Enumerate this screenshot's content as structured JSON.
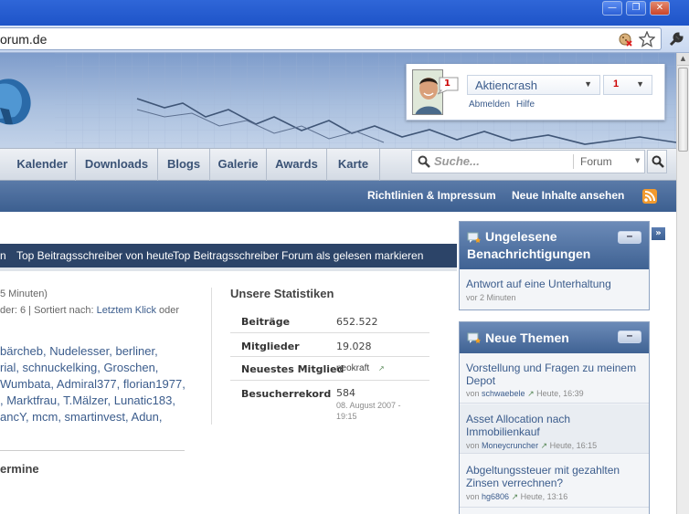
{
  "browser": {
    "url": "orum.de",
    "window_buttons": {
      "minimize": "—",
      "restore": "❐",
      "close": "✕"
    }
  },
  "user": {
    "name": "Aktiencrash",
    "notif_count": "1",
    "badge_count": "1",
    "logout": "Abmelden",
    "help": "Hilfe"
  },
  "nav": {
    "items": [
      "Kalender",
      "Downloads",
      "Blogs",
      "Galerie",
      "Awards",
      "Karte"
    ],
    "search_placeholder": "Suche...",
    "search_scope": "Forum"
  },
  "subnav": {
    "rules": "Richtlinien & Impressum",
    "new_content": "Neue Inhalte ansehen"
  },
  "linkbar": {
    "items": [
      "n",
      "Top Beitragsschreiber von heute",
      "Top Beitragsschreiber",
      "Forum als gelesen markieren"
    ]
  },
  "online": {
    "line1": "5 Minuten)",
    "line2_prefix": "der: 6 | Sortiert nach: ",
    "line2_link": "Letztem Klick",
    "line2_suffix": " oder",
    "users": [
      "bärcheb, Nudelesser, berliner,",
      "rial, schnuckelking, Groschen,",
      "Wumbata, Admiral377, florian1977,",
      ", Marktfrau, T.Mälzer, Lunatic183,",
      "ancY, mcm, smartinvest, Adun,"
    ],
    "termine": "ermine"
  },
  "stats": {
    "title": "Unsere Statistiken",
    "rows": [
      {
        "label": "Beiträge",
        "value": "652.522"
      },
      {
        "label": "Mitglieder",
        "value": "19.028"
      },
      {
        "label": "Neuestes Mitglied",
        "value": "neokraft"
      },
      {
        "label": "Besucherrekord",
        "value": "584",
        "sub": "08. August 2007 - 19:15"
      }
    ]
  },
  "notifications": {
    "title_line1": "Ungelesene",
    "title_line2": "Benachrichtigungen",
    "item_title": "Antwort auf eine Unterhaltung",
    "item_time": "vor 2 Minuten"
  },
  "threads": {
    "title": "Neue Themen",
    "items": [
      {
        "title_line1": "Vorstellung und Fragen zu meinem",
        "title_line2": "Depot",
        "by": "von",
        "author": "schwaebele",
        "time": "Heute, 16:39"
      },
      {
        "title_line1": "Asset Allocation nach",
        "title_line2": "Immobilienkauf",
        "by": "von",
        "author": "Moneycruncher",
        "time": "Heute, 16:15"
      },
      {
        "title_line1": "Abgeltungssteuer mit gezahlten",
        "title_line2": "Zinsen verrechnen?",
        "by": "von",
        "author": "hg6806",
        "time": "Heute, 13:16"
      }
    ]
  },
  "colors": {
    "titlebar": "#1e54c8",
    "nav_text": "#3a5275",
    "link": "#3b5c8c",
    "linkbar": "#2c4468"
  }
}
